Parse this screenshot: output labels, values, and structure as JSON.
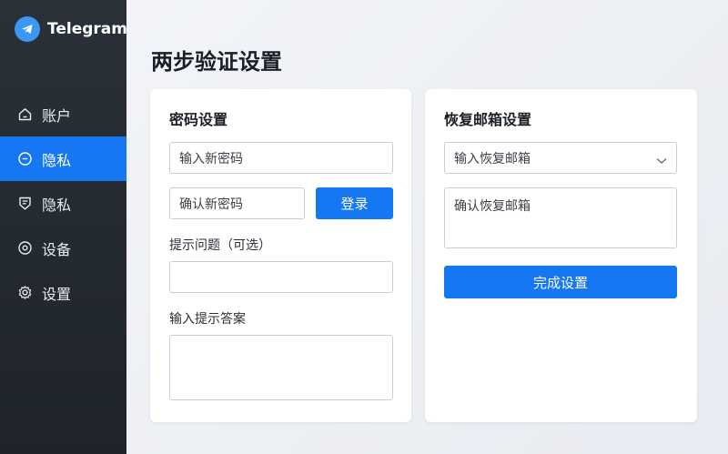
{
  "brand": {
    "name": "Telegram",
    "logo_icon": "telegram-icon",
    "logo_color": "#3a97f3"
  },
  "sidebar": {
    "active_color": "#1677f2",
    "items": [
      {
        "label": "账户",
        "icon": "home-icon"
      },
      {
        "label": "隐私",
        "icon": "minus-circle-icon",
        "active": true
      },
      {
        "label": "隐私",
        "icon": "shield-doc-icon"
      },
      {
        "label": "设备",
        "icon": "circle-dot-icon"
      },
      {
        "label": "设置",
        "icon": "gear-icon"
      }
    ]
  },
  "page": {
    "title": "两步验证设置"
  },
  "password_card": {
    "title": "密码设置",
    "new_password_placeholder": "输入新密码",
    "confirm_password_placeholder": "确认新密码",
    "login_button": "登录",
    "hint_question_label": "提示问题（可选）",
    "hint_question_value": "",
    "hint_answer_label": "输入提示答案",
    "hint_answer_value": ""
  },
  "recovery_card": {
    "title": "恢复邮箱设置",
    "email_select_value": "输入恢复邮箱",
    "confirm_email_placeholder": "确认恢复邮箱",
    "finish_button": "完成设置"
  }
}
